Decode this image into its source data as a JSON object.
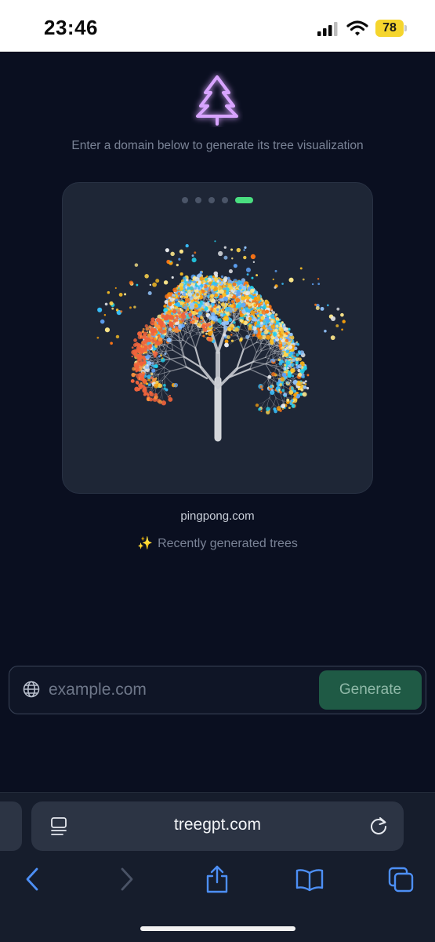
{
  "status_bar": {
    "time": "23:46",
    "battery_level": "78",
    "signal_icon": "cellular-signal-icon",
    "wifi_icon": "wifi-icon",
    "battery_color": "#f5d52d"
  },
  "app": {
    "logo_icon": "tree-icon",
    "logo_color": "#c084fc",
    "subtitle": "Enter a domain below to generate its tree visualization",
    "carousel": {
      "dot_count": 5,
      "active_index": 4,
      "active_color": "#4ade80"
    },
    "showcase_image": "domain-tree-visualization",
    "domain_label": "pingpong.com",
    "recent_sparkle": "✨",
    "recent_label": "Recently generated trees",
    "input_icon": "globe-icon",
    "input_placeholder": "example.com",
    "input_value": "",
    "generate_label": "Generate",
    "accent_green": "#1f5a45"
  },
  "browser": {
    "url": "treegpt.com",
    "reader_icon": "reader-mode-icon",
    "reload_icon": "reload-icon",
    "toolbar_icons": [
      "back-icon",
      "forward-icon",
      "share-icon",
      "bookmarks-icon",
      "tabs-icon"
    ],
    "accent_color": "#4d8ff5"
  }
}
